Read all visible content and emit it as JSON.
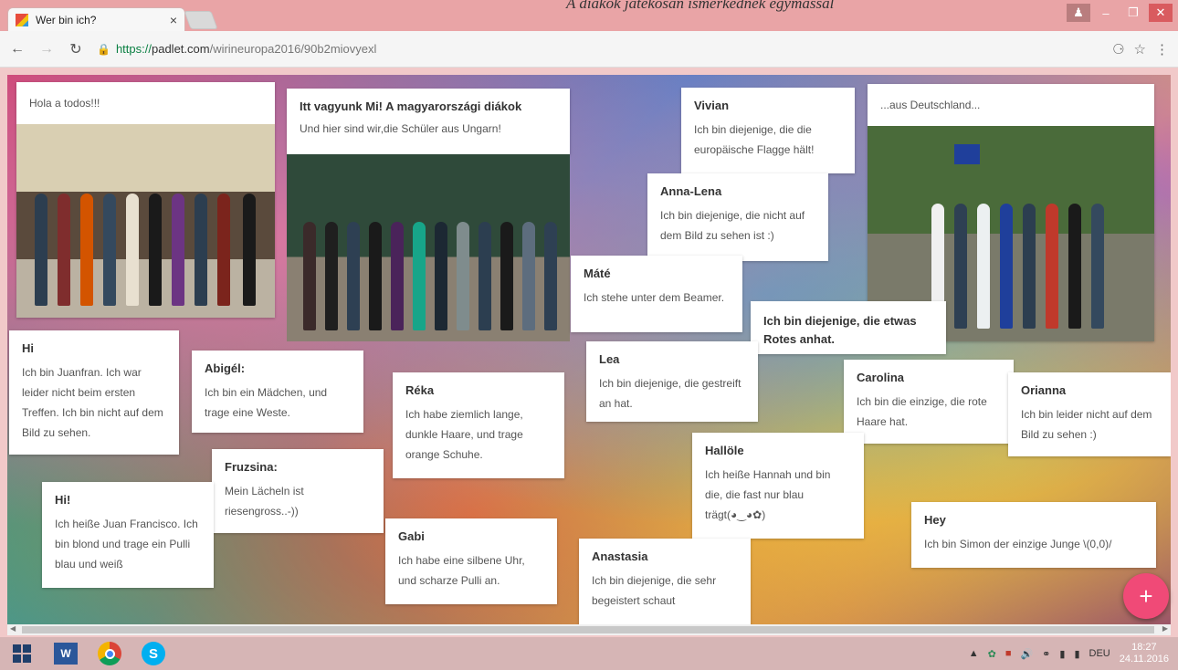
{
  "caption": "A diákok játékosan ismerkednek egymással",
  "browser": {
    "tab_title": "Wer bin ich?",
    "tab_close": "×",
    "url_scheme": "https://",
    "url_host": "padlet.com",
    "url_path": "/wirineuropa2016/90b2miovyexl"
  },
  "posts": {
    "hola": {
      "body": "Hola a todos!!!"
    },
    "itt": {
      "title": "Itt vagyunk Mi! A magyarországi diákok",
      "body": "Und hier sind wir,die Schüler aus Ungarn!"
    },
    "vivian": {
      "title": "Vivian",
      "body": "Ich bin diejenige, die die europäische Flagge hält!"
    },
    "aus": {
      "body": "...aus Deutschland..."
    },
    "annalena": {
      "title": "Anna-Lena",
      "body": "Ich bin diejenige, die nicht auf dem Bild zu sehen ist :)"
    },
    "mate": {
      "title": "Máté",
      "body": "Ich stehe unter dem Beamer."
    },
    "etwas": {
      "title": "Ich bin diejenige, die etwas Rotes anhat."
    },
    "hi1": {
      "title": "Hi",
      "body": "Ich bin Juanfran. Ich war leider nicht beim ersten Treffen. Ich bin nicht auf dem Bild zu sehen."
    },
    "abigel": {
      "title": "Abigél:",
      "body": "Ich bin ein Mädchen, und trage eine Weste."
    },
    "lea": {
      "title": "Lea",
      "body": "Ich bin diejenige, die gestreift an hat."
    },
    "reka": {
      "title": "Réka",
      "body": "Ich habe ziemlich lange, dunkle Haare, und trage orange Schuhe."
    },
    "carolina": {
      "title": "Carolina",
      "body": "Ich bin die einzige, die rote Haare hat."
    },
    "orianna": {
      "title": "Orianna",
      "body": "Ich bin leider nicht auf dem Bild zu sehen :)"
    },
    "fruzsina": {
      "title": "Fruzsina:",
      "body": "Mein Lächeln ist riesengross..-))"
    },
    "hallole": {
      "title": "Hallöle",
      "body": "Ich heiße Hannah und bin die, die fast nur blau trägt(◕‿◕✿)"
    },
    "hi2": {
      "title": "Hi!",
      "body": "Ich heiße Juan Francisco. Ich bin blond und trage ein Pulli blau und weiß"
    },
    "gabi": {
      "title": "Gabi",
      "body": "Ich habe eine silbene Uhr, und scharze Pulli an."
    },
    "hey": {
      "title": "Hey",
      "body": "Ich bin Simon der einzige Junge \\(0,0)/"
    },
    "anastasia": {
      "title": "Anastasia",
      "body": "Ich bin diejenige, die sehr begeistert schaut"
    }
  },
  "fab_label": "+",
  "taskbar": {
    "word_label": "W",
    "skype_label": "S",
    "language": "DEU",
    "time": "18:27",
    "date": "24.11.2016"
  },
  "colors": {
    "fab": "#f04a77",
    "titlebar": "#e9a4a6",
    "taskbar": "#d6b5b5"
  }
}
